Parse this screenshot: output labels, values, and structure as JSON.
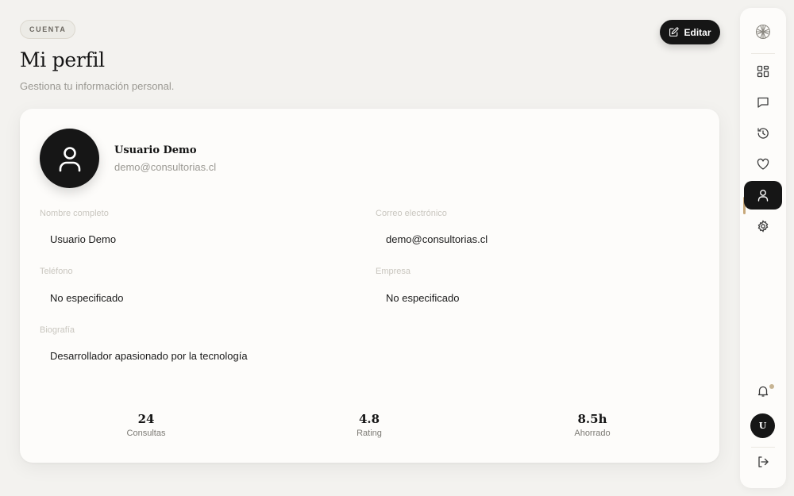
{
  "header": {
    "section_label": "CUENTA",
    "title": "Mi perfil",
    "subtitle": "Gestiona tu información personal.",
    "edit_label": "Editar"
  },
  "profile": {
    "name": "Usuario Demo",
    "email": "demo@consultorias.cl"
  },
  "fields": {
    "full_name": {
      "label": "Nombre completo",
      "value": "Usuario Demo"
    },
    "email": {
      "label": "Correo electrónico",
      "value": "demo@consultorias.cl"
    },
    "phone": {
      "label": "Teléfono",
      "value": "No especificado"
    },
    "company": {
      "label": "Empresa",
      "value": "No especificado"
    },
    "bio": {
      "label": "Biografía",
      "value": "Desarrollador apasionado por la tecnología"
    }
  },
  "stats": [
    {
      "value": "24",
      "label": "Consultas"
    },
    {
      "value": "4.8",
      "label": "Rating"
    },
    {
      "value": "8.5h",
      "label": "Ahorrado"
    }
  ],
  "sidebar": {
    "items": [
      {
        "icon": "logo-icon"
      },
      {
        "icon": "dashboard-grid-icon"
      },
      {
        "icon": "chat-icon"
      },
      {
        "icon": "history-icon"
      },
      {
        "icon": "heart-icon"
      },
      {
        "icon": "user-icon",
        "active": true
      },
      {
        "icon": "gear-icon"
      },
      {
        "icon": "bell-icon"
      },
      {
        "icon": "logout-icon"
      }
    ],
    "avatar_initial": "U"
  },
  "colors": {
    "background": "#f3f2ef",
    "card": "#fdfcfa",
    "accent_dark": "#161616",
    "active_indicator": "#c7a87a"
  }
}
